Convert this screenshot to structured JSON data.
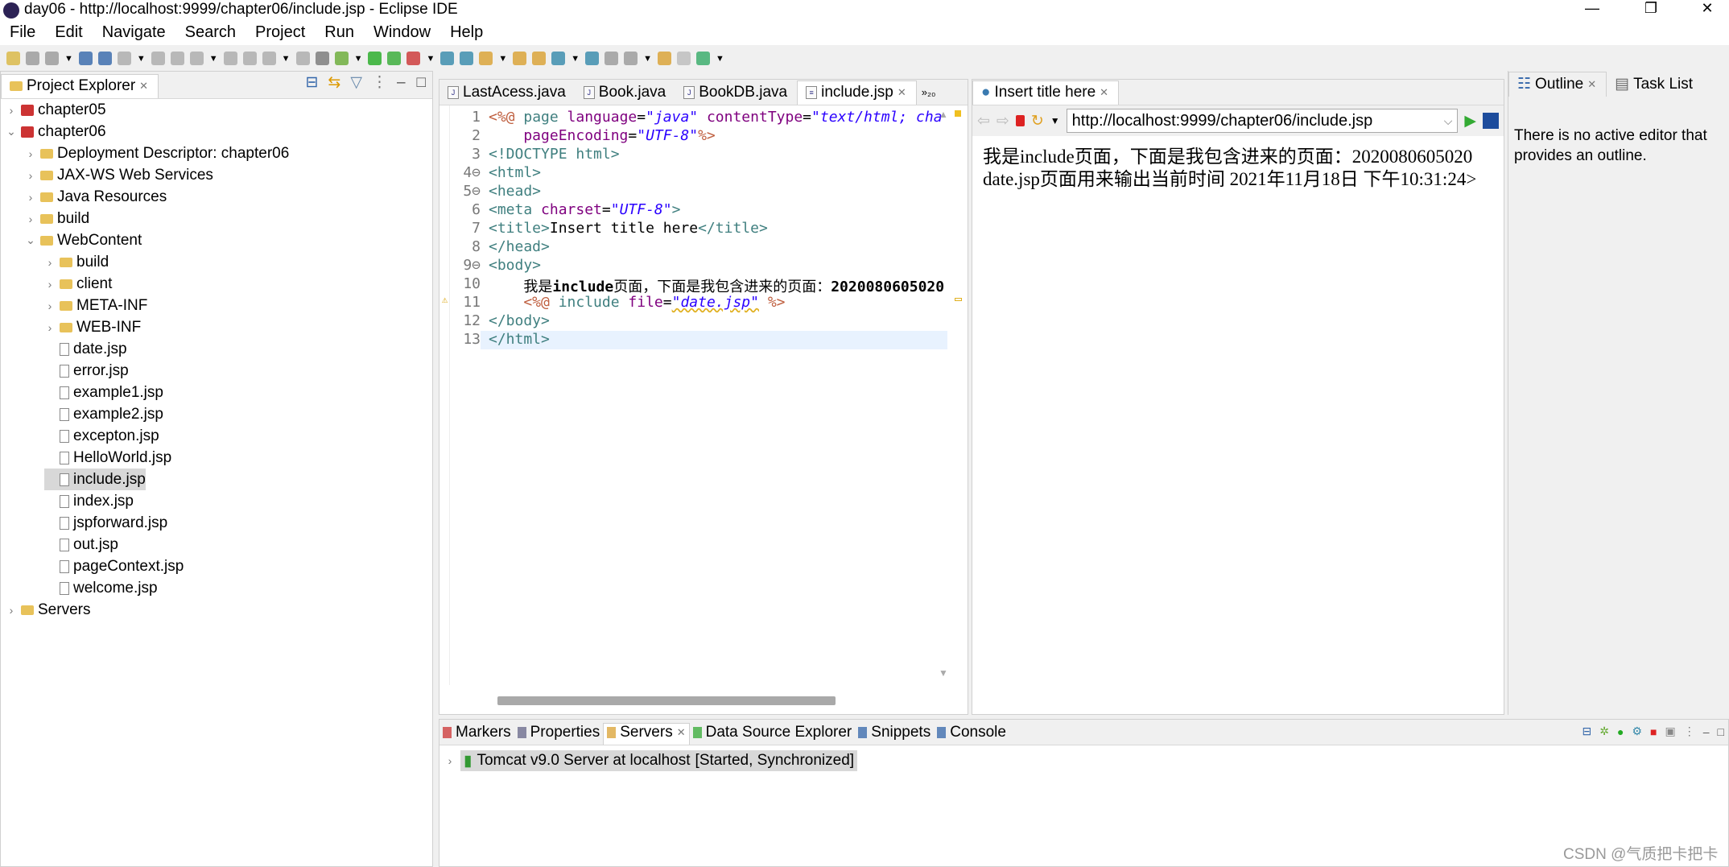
{
  "window": {
    "title": "day06 - http://localhost:9999/chapter06/include.jsp - Eclipse IDE",
    "minimize": "—",
    "restore": "❐",
    "close": "✕"
  },
  "menu": [
    "File",
    "Edit",
    "Navigate",
    "Search",
    "Project",
    "Run",
    "Window",
    "Help"
  ],
  "project_explorer": {
    "title": "Project Explorer",
    "items": [
      {
        "label": "chapter05",
        "depth": 0,
        "twisty": ">",
        "icon": "project"
      },
      {
        "label": "chapter06",
        "depth": 0,
        "twisty": "v",
        "icon": "project"
      },
      {
        "label": "Deployment Descriptor: chapter06",
        "depth": 1,
        "twisty": ">",
        "icon": "descriptor"
      },
      {
        "label": "JAX-WS Web Services",
        "depth": 1,
        "twisty": ">",
        "icon": "webservice"
      },
      {
        "label": "Java Resources",
        "depth": 1,
        "twisty": ">",
        "icon": "java-resources"
      },
      {
        "label": "build",
        "depth": 1,
        "twisty": ">",
        "icon": "folder"
      },
      {
        "label": "WebContent",
        "depth": 1,
        "twisty": "v",
        "icon": "folder"
      },
      {
        "label": "build",
        "depth": 2,
        "twisty": ">",
        "icon": "folder"
      },
      {
        "label": "client",
        "depth": 2,
        "twisty": ">",
        "icon": "folder"
      },
      {
        "label": "META-INF",
        "depth": 2,
        "twisty": ">",
        "icon": "folder"
      },
      {
        "label": "WEB-INF",
        "depth": 2,
        "twisty": ">",
        "icon": "folder"
      },
      {
        "label": "date.jsp",
        "depth": 2,
        "twisty": "",
        "icon": "file"
      },
      {
        "label": "error.jsp",
        "depth": 2,
        "twisty": "",
        "icon": "file"
      },
      {
        "label": "example1.jsp",
        "depth": 2,
        "twisty": "",
        "icon": "file"
      },
      {
        "label": "example2.jsp",
        "depth": 2,
        "twisty": "",
        "icon": "file"
      },
      {
        "label": "excepton.jsp",
        "depth": 2,
        "twisty": "",
        "icon": "file"
      },
      {
        "label": "HelloWorld.jsp",
        "depth": 2,
        "twisty": "",
        "icon": "file"
      },
      {
        "label": "include.jsp",
        "depth": 2,
        "twisty": "",
        "icon": "file",
        "selected": true
      },
      {
        "label": "index.jsp",
        "depth": 2,
        "twisty": "",
        "icon": "file"
      },
      {
        "label": "jspforward.jsp",
        "depth": 2,
        "twisty": "",
        "icon": "file"
      },
      {
        "label": "out.jsp",
        "depth": 2,
        "twisty": "",
        "icon": "file"
      },
      {
        "label": "pageContext.jsp",
        "depth": 2,
        "twisty": "",
        "icon": "file"
      },
      {
        "label": "welcome.jsp",
        "depth": 2,
        "twisty": "",
        "icon": "file"
      },
      {
        "label": "Servers",
        "depth": 0,
        "twisty": ">",
        "icon": "folder"
      }
    ]
  },
  "editor": {
    "tabs": [
      "LastAcess.java",
      "Book.java",
      "BookDB.java",
      "include.jsp"
    ],
    "active_tab": 3,
    "overflow": "»₂₀",
    "lines": [
      {
        "n": "1",
        "seg": [
          [
            "<%@ ",
            "jsp"
          ],
          [
            "page ",
            "tag"
          ],
          [
            "language",
            "attr"
          ],
          [
            "=",
            "txt"
          ],
          [
            "\"java\"",
            "val"
          ],
          [
            " contentType",
            "attr"
          ],
          [
            "=",
            "txt"
          ],
          [
            "\"text/html; cha",
            "val"
          ]
        ]
      },
      {
        "n": "2",
        "seg": [
          [
            "    pageEncoding",
            "attr"
          ],
          [
            "=",
            "txt"
          ],
          [
            "\"UTF-8\"",
            "val"
          ],
          [
            "%>",
            "jsp"
          ]
        ]
      },
      {
        "n": "3",
        "seg": [
          [
            "<!DOCTYPE html>",
            "tag"
          ]
        ]
      },
      {
        "n": "4⊖",
        "seg": [
          [
            "<html>",
            "tag"
          ]
        ]
      },
      {
        "n": "5⊖",
        "seg": [
          [
            "<head>",
            "tag"
          ]
        ]
      },
      {
        "n": "6",
        "seg": [
          [
            "<meta ",
            "tag"
          ],
          [
            "charset",
            "attr"
          ],
          [
            "=",
            "txt"
          ],
          [
            "\"UTF-8\"",
            "val"
          ],
          [
            ">",
            "tag"
          ]
        ]
      },
      {
        "n": "7",
        "seg": [
          [
            "<title>",
            "tag"
          ],
          [
            "Insert title here",
            "txt"
          ],
          [
            "</title>",
            "tag"
          ]
        ]
      },
      {
        "n": "8",
        "seg": [
          [
            "</head>",
            "tag"
          ]
        ]
      },
      {
        "n": "9⊖",
        "seg": [
          [
            "<body>",
            "tag"
          ]
        ]
      },
      {
        "n": "10",
        "seg": [
          [
            "    我是",
            "txt"
          ],
          [
            "include",
            "bold"
          ],
          [
            "页面，下面是我包含进来的页面：",
            "txt"
          ],
          [
            "2020080605020",
            "bold"
          ]
        ]
      },
      {
        "n": "11",
        "seg": [
          [
            "    <%@ ",
            "jsp"
          ],
          [
            "include ",
            "tag"
          ],
          [
            "file",
            "attr"
          ],
          [
            "=",
            "txt"
          ],
          [
            "\"date.jsp\"",
            "val"
          ],
          [
            " %>",
            "jsp"
          ]
        ]
      },
      {
        "n": "12",
        "seg": [
          [
            "</body>",
            "tag"
          ]
        ]
      },
      {
        "n": "13",
        "seg": [
          [
            "</html>",
            "tag"
          ]
        ]
      }
    ]
  },
  "browser": {
    "tab": "Insert title here",
    "url": "http://localhost:9999/chapter06/include.jsp",
    "content": "我是include页面，下面是我包含进来的页面：2020080605020 date.jsp页面用来输出当前时间 2021年11月18日 下午10:31:24>"
  },
  "outline": {
    "tabs": [
      "Outline",
      "Task List"
    ],
    "message": "There is no active editor that provides an outline."
  },
  "bottom": {
    "tabs": [
      "Markers",
      "Properties",
      "Servers",
      "Data Source Explorer",
      "Snippets",
      "Console"
    ],
    "active_tab": 2,
    "server_name": "Tomcat v9.0 Server at localhost",
    "server_status": "[Started, Synchronized]"
  },
  "watermark": "CSDN @气质把卡把卡",
  "colors": {
    "tag": "#3f7f7f",
    "attr": "#7f007f",
    "value": "#2a00ff",
    "jsp": "#bf5f3f",
    "current_line": "#e8f2fe"
  }
}
